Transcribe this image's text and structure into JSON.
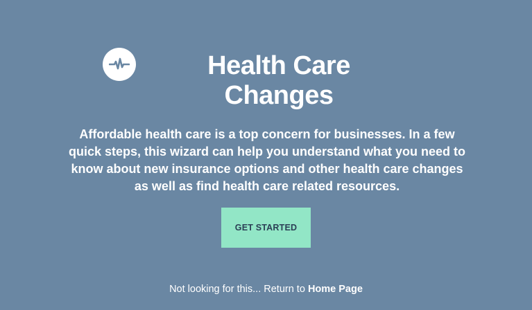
{
  "icon": {
    "name": "heartbeat-icon",
    "color": "#6a87a3"
  },
  "title": {
    "line1": "Health Care",
    "line2": "Changes"
  },
  "description": "Affordable health care is a top concern for businesses. In a few quick steps, this wizard can help you understand what you need to know about new insurance options and other health care changes as well as find health care related resources.",
  "cta": {
    "label": "GET STARTED",
    "background": "#92e6c6"
  },
  "footer": {
    "prefix": "Not looking for this... Return to ",
    "link_label": "Home Page"
  },
  "colors": {
    "background": "#6a87a3",
    "text": "#ffffff"
  }
}
